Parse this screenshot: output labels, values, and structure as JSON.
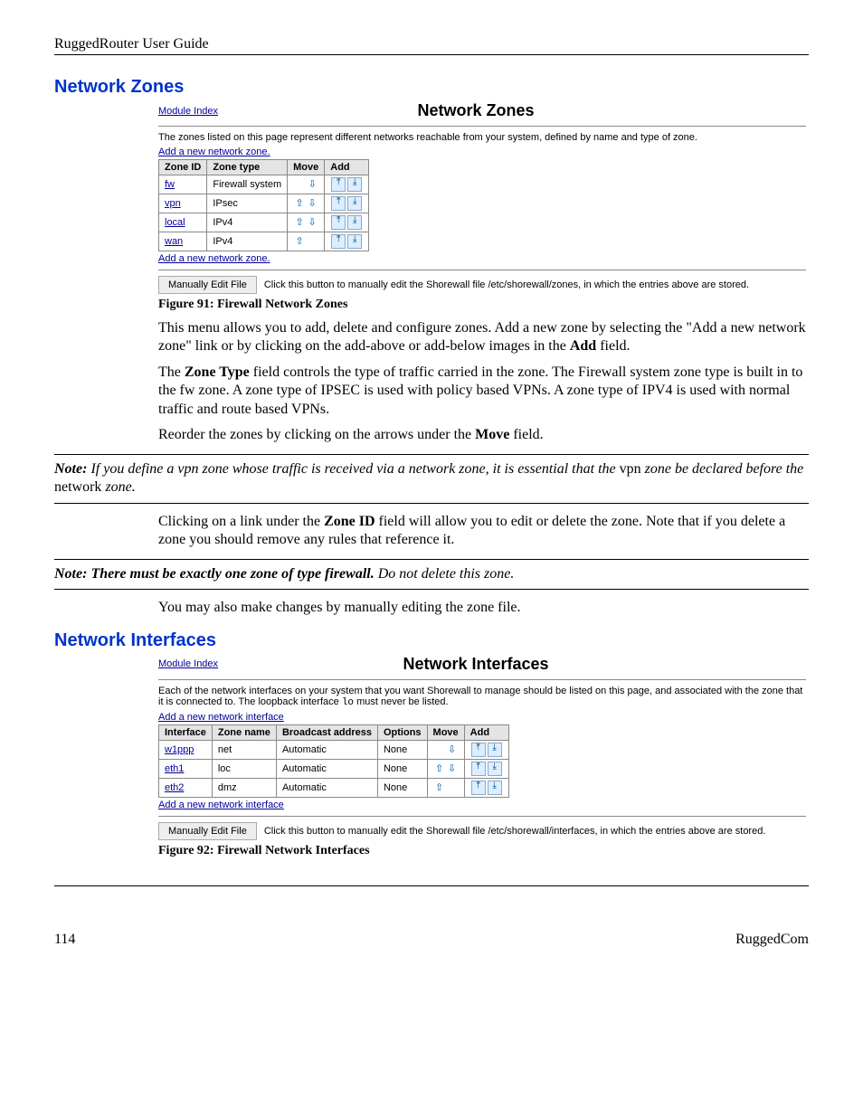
{
  "header": {
    "left": "RuggedRouter   User Guide"
  },
  "section1": {
    "heading": "Network Zones",
    "ss": {
      "module_index": "Module Index",
      "title": "Network Zones",
      "intro": "The zones listed on this page represent different networks reachable from your system, defined by name and type of zone.",
      "add_link": "Add a new network zone.",
      "cols": {
        "c1": "Zone ID",
        "c2": "Zone type",
        "c3": "Move",
        "c4": "Add"
      },
      "rows": [
        {
          "id": "fw",
          "type": "Firewall system",
          "move_up": false,
          "move_dn": true
        },
        {
          "id": "vpn",
          "type": "IPsec",
          "move_up": true,
          "move_dn": true
        },
        {
          "id": "local",
          "type": "IPv4",
          "move_up": true,
          "move_dn": true
        },
        {
          "id": "wan",
          "type": "IPv4",
          "move_up": true,
          "move_dn": false
        }
      ],
      "btn": "Manually Edit File",
      "btn_desc": "Click this button to manually edit the Shorewall file /etc/shorewall/zones, in which the entries above are stored."
    },
    "caption": "Figure 91: Firewall Network Zones",
    "p1a": "This menu allows you to add, delete and configure zones.  Add a new zone by selecting the \"Add a new network zone\" link or by clicking on the add-above or add-below images in the ",
    "p1b_bold": "Add",
    "p1c": " field.",
    "p2a": "The ",
    "p2b_bold": "Zone Type",
    "p2c": " field controls the type of traffic carried in the zone.  The Firewall system zone type is built in to the fw zone.  A zone type of IPSEC is used with policy based VPNs.   A zone type of IPV4 is used with normal traffic and route based VPNs.",
    "p3a": "Reorder the zones by clicking on the arrows under the ",
    "p3b_bold": "Move",
    "p3c": " field.",
    "note1_bold": "Note:",
    "note1_a": "  If you define a vpn zone whose traffic is received via a network zone, it is essential that the ",
    "note1_b": "vpn ",
    "note1_c": "zone be declared before the ",
    "note1_d": "network ",
    "note1_e": "zone.",
    "p4a": "Clicking on a link under the ",
    "p4b_bold": "Zone ID",
    "p4c": " field will allow you to edit or delete the zone. Note that if you delete a zone you should remove any rules that reference it.",
    "note2_bold": "Note:",
    "note2_a": "  There must be exactly one zone of type firewall.",
    "note2_b": "  Do not delete this zone.",
    "p5": "You may also make changes by manually editing the zone file."
  },
  "section2": {
    "heading": "Network Interfaces",
    "ss": {
      "module_index": "Module Index",
      "title": "Network Interfaces",
      "intro_a": "Each of the network interfaces on your system that you want Shorewall to manage should be listed on this page, and associated with the zone that it is connected to. The loopback interface ",
      "intro_mono": "lo",
      "intro_b": " must never be listed.",
      "add_link": "Add a new network interface",
      "cols": {
        "c1": "Interface",
        "c2": "Zone name",
        "c3": "Broadcast address",
        "c4": "Options",
        "c5": "Move",
        "c6": "Add"
      },
      "rows": [
        {
          "iface": "w1ppp",
          "zone": "net",
          "bcast": "Automatic",
          "opts": "None",
          "move_up": false,
          "move_dn": true
        },
        {
          "iface": "eth1",
          "zone": "loc",
          "bcast": "Automatic",
          "opts": "None",
          "move_up": true,
          "move_dn": true
        },
        {
          "iface": "eth2",
          "zone": "dmz",
          "bcast": "Automatic",
          "opts": "None",
          "move_up": true,
          "move_dn": false
        }
      ],
      "btn": "Manually Edit File",
      "btn_desc": "Click this button to manually edit the Shorewall file /etc/shorewall/interfaces, in which the entries above are stored."
    },
    "caption": "Figure 92: Firewall Network Interfaces"
  },
  "footer": {
    "page": "114",
    "right": "RuggedCom"
  },
  "icons": {
    "up": "⇧",
    "down": "⇩",
    "add_top": "⤒",
    "add_bot": "⤓"
  }
}
